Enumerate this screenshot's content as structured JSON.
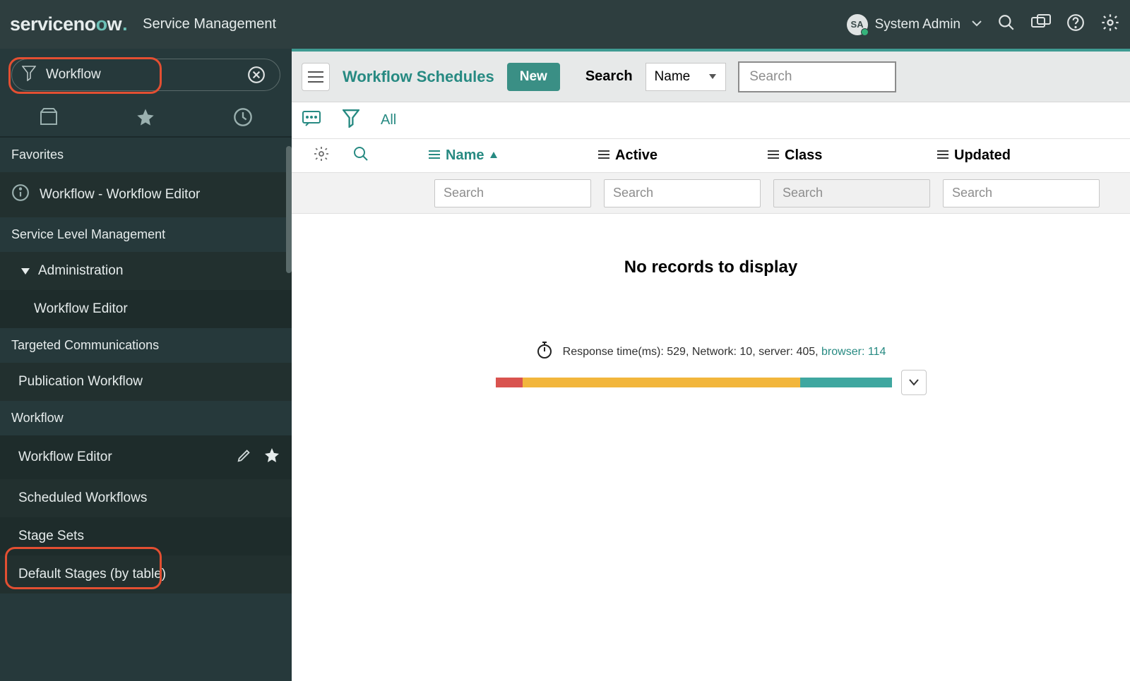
{
  "banner": {
    "logo_text_a": "serviceno",
    "logo_text_o": "o",
    "logo_text_w": "w",
    "app_title": "Service Management",
    "user_initials": "SA",
    "user_name": "System Admin"
  },
  "nav": {
    "filter_value": "Workflow",
    "favorites_hdr": "Favorites",
    "fav_item": "Workflow - Workflow Editor",
    "slm_hdr": "Service Level Management",
    "slm_admin": "Administration",
    "slm_wf_editor": "Workflow Editor",
    "tc_hdr": "Targeted Communications",
    "tc_pub_wf": "Publication Workflow",
    "wf_hdr": "Workflow",
    "wf_items": {
      "editor": "Workflow Editor",
      "scheduled": "Scheduled Workflows",
      "stage_sets": "Stage Sets",
      "default_stages": "Default Stages (by table)"
    }
  },
  "list": {
    "title": "Workflow Schedules",
    "new_btn": "New",
    "search_label": "Search",
    "search_field_sel": "Name",
    "search_placeholder": "Search",
    "all_label": "All",
    "columns": {
      "name": "Name",
      "active": "Active",
      "class": "Class",
      "updated": "Updated"
    },
    "col_search_ph": "Search",
    "empty_msg": "No records to display"
  },
  "perf": {
    "text_a": "Response time(ms): 529, Network: 10, server: 405, ",
    "text_link": "browser: 114",
    "seg_red_pct": 6.9,
    "seg_yel_pct": 69.8,
    "seg_teal_pct": 23.3
  }
}
